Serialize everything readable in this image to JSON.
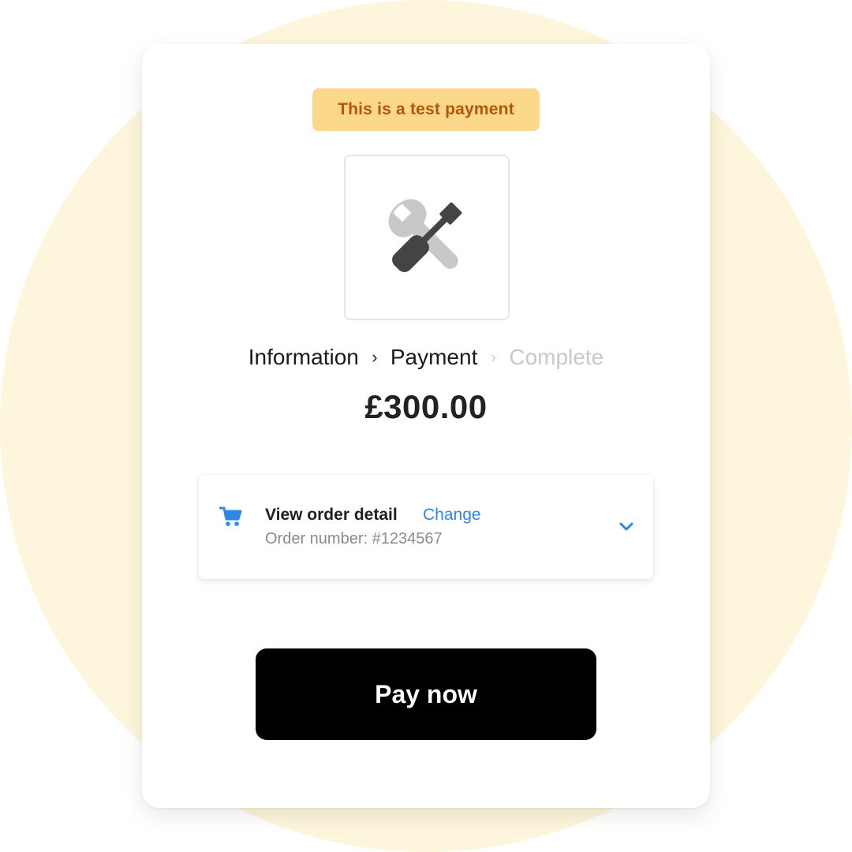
{
  "test_badge": {
    "label": "This is a test payment"
  },
  "merchant_logo": {
    "icon": "tools-icon",
    "colors": {
      "screwdriver": "#444444",
      "wrench": "#c8c8c8"
    }
  },
  "steps": [
    {
      "label": "Information",
      "state": "done"
    },
    {
      "label": "Payment",
      "state": "current"
    },
    {
      "label": "Complete",
      "state": "upcoming"
    }
  ],
  "amount": "£300.00",
  "order": {
    "title": "View order detail",
    "change_label": "Change",
    "number": "Order number: #1234567",
    "icon": "cart-icon",
    "toggle_icon": "chevron-down-icon"
  },
  "pay_button": {
    "label": "Pay now"
  },
  "colors": {
    "background_circle": "#fdf6dc",
    "badge_bg": "#fcd98a",
    "badge_text": "#b6540e",
    "accent_blue": "#2f87e8",
    "button_bg": "#000000"
  }
}
